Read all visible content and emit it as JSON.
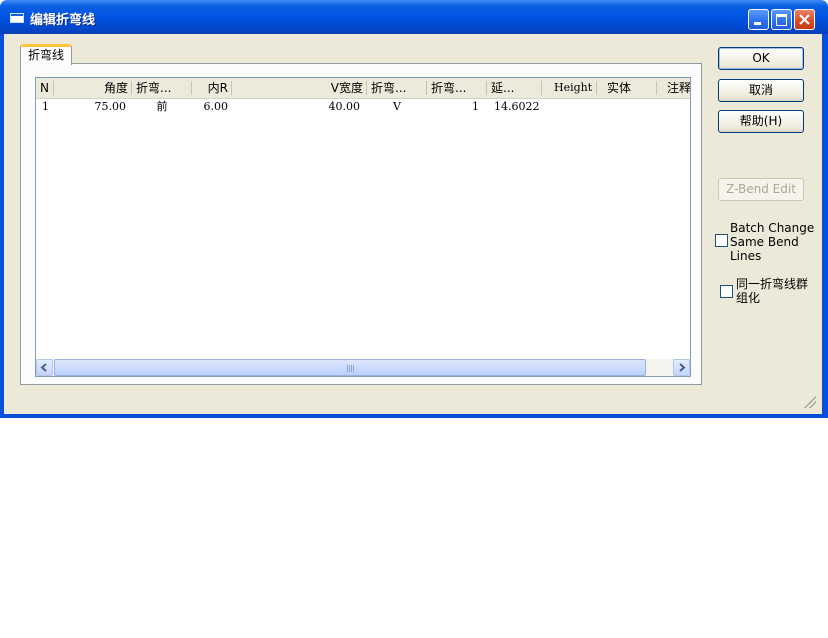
{
  "window": {
    "title": "编辑折弯线"
  },
  "tab": {
    "label": "折弯线"
  },
  "table": {
    "columns": [
      "N",
      "角度",
      "折弯...",
      "内R",
      "V宽度",
      "折弯...",
      "折弯...",
      "延...",
      "Height",
      "实体",
      "注释"
    ],
    "rows": [
      {
        "n": "1",
        "angle": "75.00",
        "bend_dir": "前",
        "inner_r": "6.00",
        "v_width": "40.00",
        "bend_type": "V",
        "bend_count": "1",
        "extension": "14.6022",
        "height": "",
        "solid": "",
        "note": ""
      }
    ]
  },
  "buttons": {
    "ok": "OK",
    "cancel": "取消",
    "help": "帮助(H)",
    "zbend": "Z-Bend Edit"
  },
  "options": {
    "batch_change_line1": "Batch Change",
    "batch_change_line2": "Same Bend",
    "batch_change_line3": "Lines",
    "group_line1": "同一折弯线群",
    "group_line2": "组化"
  }
}
